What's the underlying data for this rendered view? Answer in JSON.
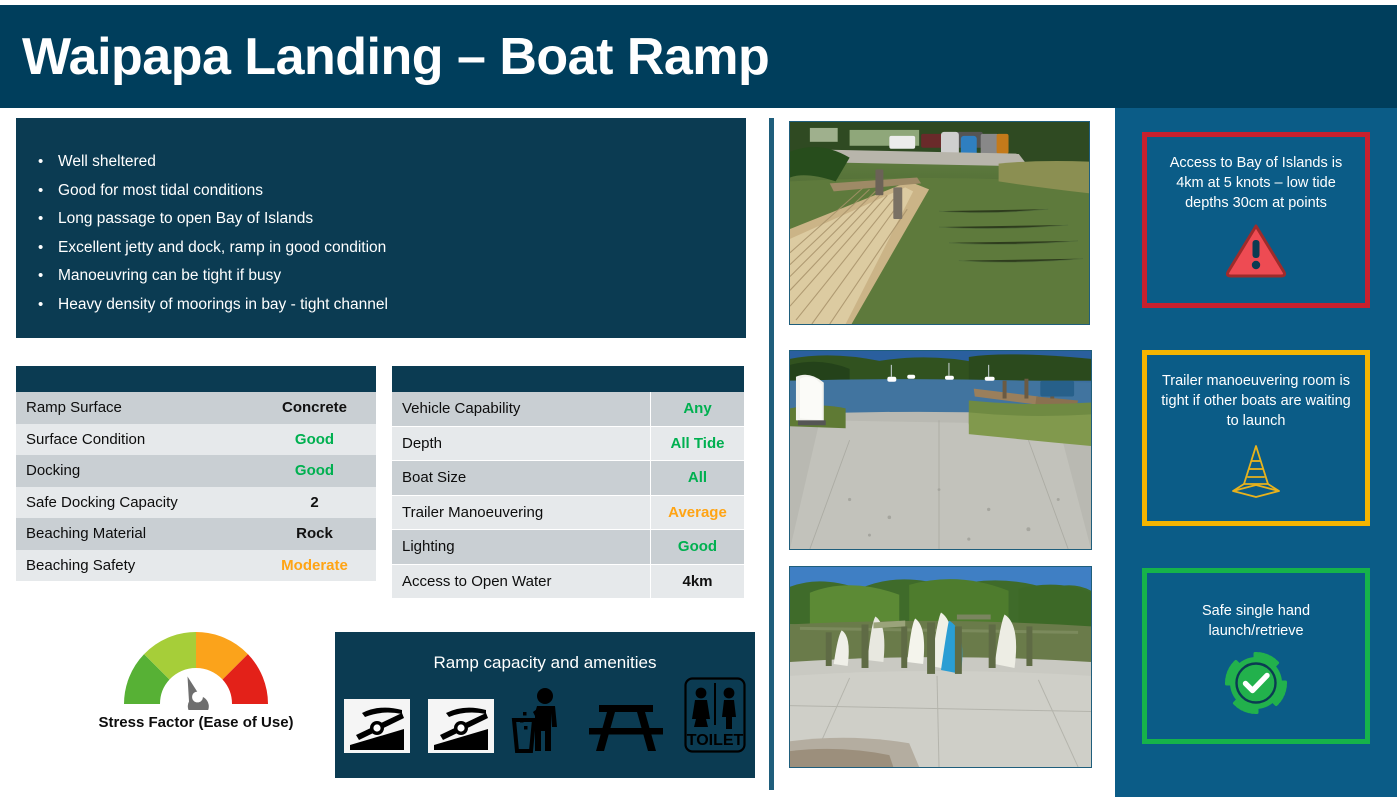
{
  "header": {
    "title": "Waipapa Landing – Boat Ramp",
    "bg": "#003E5C"
  },
  "bullets": {
    "items": [
      "Well sheltered",
      "Good for most tidal conditions",
      "Long passage to open Bay of Islands",
      "Excellent jetty and dock, ramp in good condition",
      "Manoeuvring can be tight if busy",
      "Heavy density of moorings in bay - tight channel"
    ],
    "bullet_glyph": "•"
  },
  "table_left": {
    "rows": [
      {
        "key": "Ramp Surface",
        "value": "Concrete",
        "style": "val-dark"
      },
      {
        "key": "Surface Condition",
        "value": "Good",
        "style": "val-green"
      },
      {
        "key": "Docking",
        "value": "Good",
        "style": "val-green"
      },
      {
        "key": "Safe Docking Capacity",
        "value": "2",
        "style": "val-dark"
      },
      {
        "key": "Beaching Material",
        "value": "Rock",
        "style": "val-dark"
      },
      {
        "key": "Beaching Safety",
        "value": "Moderate",
        "style": "val-orange"
      }
    ]
  },
  "table_right": {
    "rows": [
      {
        "key": "Vehicle Capability",
        "value": "Any",
        "style": "val-green"
      },
      {
        "key": "Depth",
        "value": "All Tide",
        "style": "val-green"
      },
      {
        "key": "Boat Size",
        "value": "All",
        "style": "val-green"
      },
      {
        "key": "Trailer Manoeuvering",
        "value": "Average",
        "style": "val-orange"
      },
      {
        "key": "Lighting",
        "value": "Good",
        "style": "val-green"
      },
      {
        "key": "Access to Open Water",
        "value": "4km",
        "style": "val-dark"
      }
    ]
  },
  "gauge": {
    "label": "Stress Factor (Ease of Use)",
    "segment_colors": [
      "#57B135",
      "#A6CE39",
      "#FBA31B",
      "#E32119"
    ],
    "needle_color": "#6E6E6E"
  },
  "amenities": {
    "title": "Ramp capacity and amenities",
    "icons": [
      "boat-ramp-icon",
      "boat-ramp-icon",
      "rubbish-bin-icon",
      "picnic-table-icon",
      "toilet-icon"
    ],
    "toilet_label": "TOILET"
  },
  "photos": [
    {
      "name": "photo-jetty-and-ramp",
      "caption": "Wooden jetty alongside concrete boat ramp in green tidal water"
    },
    {
      "name": "photo-ramp-to-water",
      "caption": "Wide concrete ramp leading down to blue water with jetty at right"
    },
    {
      "name": "photo-dinghy-racks",
      "caption": "Concrete hardstand with dinghies and kayaks stored on racks"
    }
  ],
  "callouts": [
    {
      "id": "callout-red",
      "text": "Access to Bay of Islands is 4km at 5 knots – low tide depths 30cm at points",
      "border_color": "#C8202E",
      "icon": "warning-triangle-icon"
    },
    {
      "id": "callout-yellow",
      "text": "Trailer manoeuvering room is tight if other boats are waiting to launch",
      "border_color": "#F5B400",
      "icon": "traffic-cone-icon"
    },
    {
      "id": "callout-green",
      "text": "Safe single hand launch/retrieve",
      "border_color": "#16B34A",
      "icon": "check-badge-icon"
    }
  ]
}
